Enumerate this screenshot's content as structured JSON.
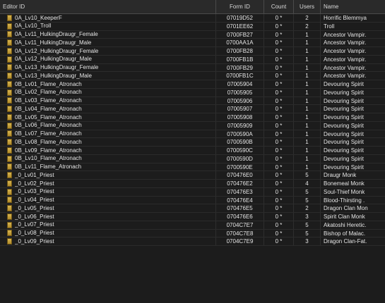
{
  "columns": {
    "editor_id": "Editor ID",
    "form_id": "Form ID",
    "count": "Count",
    "users": "Users",
    "name": "Name"
  },
  "rows": [
    {
      "editor_id": "0A_Lv10_KeeperF",
      "form_id": "07019D52",
      "count": "0 *",
      "users": "2",
      "name": "Horrific Blemmya"
    },
    {
      "editor_id": "0A_Lv10_Troll",
      "form_id": "0701EE62",
      "count": "0 *",
      "users": "2",
      "name": "Troll"
    },
    {
      "editor_id": "0A_Lv11_HulkingDraugr_Female",
      "form_id": "0700FB27",
      "count": "0 *",
      "users": "1",
      "name": "Ancestor Vampir."
    },
    {
      "editor_id": "0A_Lv11_HulkingDraugr_Male",
      "form_id": "0700AA1A",
      "count": "0 *",
      "users": "1",
      "name": "Ancestor Vampir."
    },
    {
      "editor_id": "0A_Lv12_HulkingDraugr_Female",
      "form_id": "0700FB28",
      "count": "0 *",
      "users": "1",
      "name": "Ancestor Vampir."
    },
    {
      "editor_id": "0A_Lv12_HulkingDraugr_Male",
      "form_id": "0700FB1B",
      "count": "0 *",
      "users": "1",
      "name": "Ancestor Vampir."
    },
    {
      "editor_id": "0A_Lv13_HulkingDraugr_Female",
      "form_id": "0700FB29",
      "count": "0 *",
      "users": "1",
      "name": "Ancestor Vampir."
    },
    {
      "editor_id": "0A_Lv13_HulkingDraugr_Male",
      "form_id": "0700FB1C",
      "count": "0 *",
      "users": "1",
      "name": "Ancestor Vampir."
    },
    {
      "editor_id": "0B_Lv01_Flame_Atronach",
      "form_id": "07005904",
      "count": "0 *",
      "users": "1",
      "name": "Devouring Spirit"
    },
    {
      "editor_id": "0B_Lv02_Flame_Atronach",
      "form_id": "07005905",
      "count": "0 *",
      "users": "1",
      "name": "Devouring Spirit"
    },
    {
      "editor_id": "0B_Lv03_Flame_Atronach",
      "form_id": "07005906",
      "count": "0 *",
      "users": "1",
      "name": "Devouring Spirit"
    },
    {
      "editor_id": "0B_Lv04_Flame_Atronach",
      "form_id": "07005907",
      "count": "0 *",
      "users": "1",
      "name": "Devouring Spirit"
    },
    {
      "editor_id": "0B_Lv05_Flame_Atronach",
      "form_id": "07005908",
      "count": "0 *",
      "users": "1",
      "name": "Devouring Spirit"
    },
    {
      "editor_id": "0B_Lv06_Flame_Atronach",
      "form_id": "07005909",
      "count": "0 *",
      "users": "1",
      "name": "Devouring Spirit"
    },
    {
      "editor_id": "0B_Lv07_Flame_Atronach",
      "form_id": "0700590A",
      "count": "0 *",
      "users": "1",
      "name": "Devouring Spirit"
    },
    {
      "editor_id": "0B_Lv08_Flame_Atronach",
      "form_id": "0700590B",
      "count": "0 *",
      "users": "1",
      "name": "Devouring Spirit"
    },
    {
      "editor_id": "0B_Lv09_Flame_Atronach",
      "form_id": "0700590C",
      "count": "0 *",
      "users": "1",
      "name": "Devouring Spirit"
    },
    {
      "editor_id": "0B_Lv10_Flame_Atronach",
      "form_id": "0700590D",
      "count": "0 *",
      "users": "1",
      "name": "Devouring Spirit"
    },
    {
      "editor_id": "0B_Lv11_Flame_Atronach",
      "form_id": "0700590E",
      "count": "0 *",
      "users": "1",
      "name": "Devouring Spirit"
    },
    {
      "editor_id": "_0_Lv01_Priest",
      "form_id": "070476E0",
      "count": "0 *",
      "users": "5",
      "name": "Draugr Monk"
    },
    {
      "editor_id": "_0_Lv02_Priest",
      "form_id": "070476E2",
      "count": "0 *",
      "users": "4",
      "name": "Bonemeal Monk"
    },
    {
      "editor_id": "_0_Lv03_Priest",
      "form_id": "070476E3",
      "count": "0 *",
      "users": "5",
      "name": "Soul-Thief Monk"
    },
    {
      "editor_id": "_0_Lv04_Priest",
      "form_id": "070476E4",
      "count": "0 *",
      "users": "5",
      "name": "Blood-Thirsting ."
    },
    {
      "editor_id": "_0_Lv05_Priest",
      "form_id": "070476E5",
      "count": "0 *",
      "users": "2",
      "name": "Dragon Clan Mon"
    },
    {
      "editor_id": "_0_Lv06_Priest",
      "form_id": "070476E6",
      "count": "0 *",
      "users": "3",
      "name": "Spirit Clan Monk"
    },
    {
      "editor_id": "_0_Lv07_Priest",
      "form_id": "0704C7E7",
      "count": "0 *",
      "users": "5",
      "name": "Akatoshi Heretic."
    },
    {
      "editor_id": "_0_Lv08_Priest",
      "form_id": "0704C7E8",
      "count": "0 *",
      "users": "5",
      "name": "Bishop of Malac."
    },
    {
      "editor_id": "_0_Lv09_Priest",
      "form_id": "0704C7E9",
      "count": "0 *",
      "users": "3",
      "name": "Dragon Clan-Fat."
    }
  ]
}
